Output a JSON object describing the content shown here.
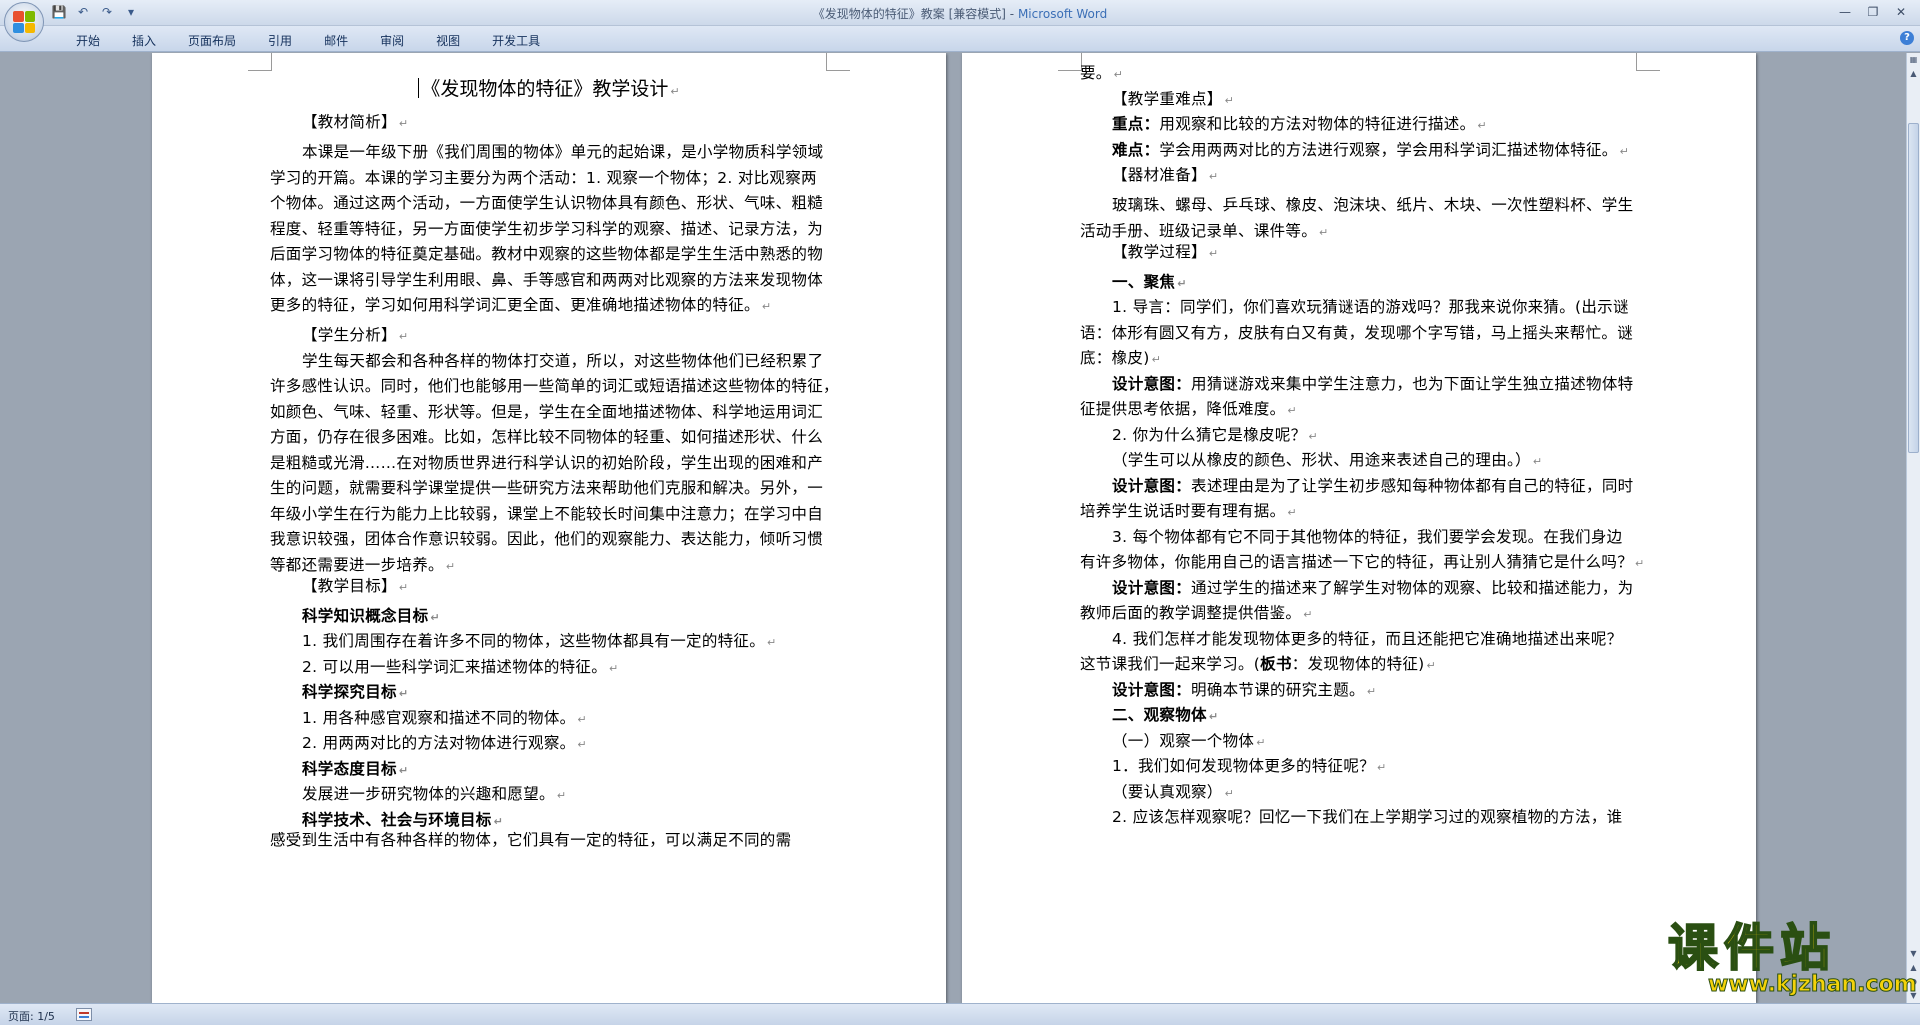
{
  "window": {
    "title": "《发现物体的特征》教案 [兼容模式] -",
    "app_name": "Microsoft Word"
  },
  "qat": {
    "icons": [
      "save-icon",
      "undo-icon",
      "redo-icon",
      "customize-icon"
    ]
  },
  "ribbon": {
    "tabs": [
      "开始",
      "插入",
      "页面布局",
      "引用",
      "邮件",
      "审阅",
      "视图",
      "开发工具"
    ]
  },
  "status": {
    "page": "页面: 1/5"
  },
  "watermark": {
    "name": "课件站",
    "url": "www.kjzhan.com"
  },
  "page1": {
    "title": "《发现物体的特征》教学设计",
    "lines": [
      "【教材简析】",
      "本课是一年级下册《我们周围的物体》单元的起始课，是小学物质科学领域",
      "学习的开篇。本课的学习主要分为两个活动：1. 观察一个物体；2. 对比观察两",
      "个物体。通过这两个活动，一方面使学生认识物体具有颜色、形状、气味、粗糙",
      "程度、轻重等特征，另一方面使学生初步学习科学的观察、描述、记录方法，为",
      "后面学习物体的特征奠定基础。教材中观察的这些物体都是学生生活中熟悉的物",
      "体，这一课将引导学生利用眼、鼻、手等感官和两两对比观察的方法来发现物体",
      "更多的特征，学习如何用科学词汇更全面、更准确地描述物体的特征。",
      "【学生分析】",
      "学生每天都会和各种各样的物体打交道，所以，对这些物体他们已经积累了",
      "许多感性认识。同时，他们也能够用一些简单的词汇或短语描述这些物体的特征，",
      "如颜色、气味、轻重、形状等。但是，学生在全面地描述物体、科学地运用词汇",
      "方面，仍存在很多困难。比如，怎样比较不同物体的轻重、如何描述形状、什么",
      "是粗糙或光滑……在对物质世界进行科学认识的初始阶段，学生出现的困难和产",
      "生的问题，就需要科学课堂提供一些研究方法来帮助他们克服和解决。另外，一",
      "年级小学生在行为能力上比较弱，课堂上不能较长时间集中注意力；在学习中自",
      "我意识较强，团体合作意识较弱。因此，他们的观察能力、表达能力，倾听习惯",
      "等都还需要进一步培养。",
      "【教学目标】",
      "科学知识概念目标",
      "1. 我们周围存在着许多不同的物体，这些物体都具有一定的特征。",
      "2. 可以用一些科学词汇来描述物体的特征。",
      "科学探究目标",
      "1. 用各种感官观察和描述不同的物体。",
      "2. 用两两对比的方法对物体进行观察。",
      "科学态度目标",
      "发展进一步研究物体的兴趣和愿望。",
      "科学技术、社会与环境目标",
      "感受到生活中有各种各样的物体，它们具有一定的特征，可以满足不同的需"
    ]
  },
  "page2": {
    "lines": [
      "要。",
      "【教学重难点】",
      "重点：",
      "用观察和比较的方法对物体的特征进行描述。",
      "难点：",
      "学会用两两对比的方法进行观察，学会用科学词汇描述物体特征。",
      "【器材准备】",
      "玻璃珠、螺母、乒乓球、橡皮、泡沫块、纸片、木块、一次性塑料杯、学生",
      "活动手册、班级记录单、课件等。",
      "【教学过程】",
      "一、聚焦",
      "1. 导言：同学们，你们喜欢玩猜谜语的游戏吗？那我来说你来猜。(出示谜",
      "语：体形有圆又有方，皮肤有白又有黄，发现哪个字写错，马上摇头来帮忙。谜",
      "底：橡皮)",
      "设计意图：",
      "用猜谜游戏来集中学生注意力，也为下面让学生独立描述物体特",
      "征提供思考依据，降低难度。",
      "2. 你为什么猜它是橡皮呢？",
      "（学生可以从橡皮的颜色、形状、用途来表述自己的理由。）",
      "设计意图：",
      "表述理由是为了让学生初步感知每种物体都有自己的特征，同时",
      "培养学生说话时要有理有据。",
      "3. 每个物体都有它不同于其他物体的特征，我们要学会发现。在我们身边",
      "有许多物体，你能用自己的语言描述一下它的特征，再让别人猜猜它是什么吗？",
      "设计意图：",
      "通过学生的描述来了解学生对物体的观察、比较和描述能力，为",
      "教师后面的教学调整提供借鉴。",
      "4. 我们怎样才能发现物体更多的特征，而且还能把它准确地描述出来呢？",
      "这节课我们一起来学习。(",
      "板书",
      "：发现物体的特征)",
      "设计意图：",
      "明确本节课的研究主题。",
      "二、观察物体",
      "（一）观察一个物体",
      "1．我们如何发现物体更多的特征呢？",
      "（要认真观察）",
      "2. 应该怎样观察呢？回忆一下我们在上学期学习过的观察植物的方法，谁"
    ]
  }
}
